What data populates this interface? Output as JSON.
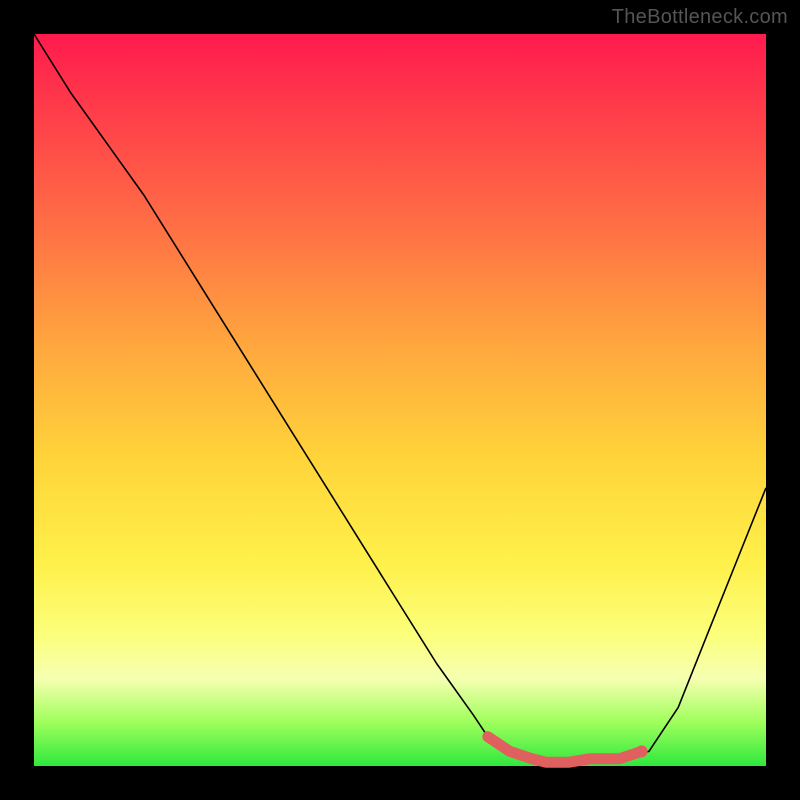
{
  "watermark": "TheBottleneck.com",
  "chart_data": {
    "type": "line",
    "title": "",
    "xlabel": "",
    "ylabel": "",
    "xlim": [
      0,
      100
    ],
    "ylim": [
      0,
      100
    ],
    "series": [
      {
        "name": "bottleneck-curve",
        "x": [
          0,
          5,
          10,
          15,
          20,
          25,
          30,
          35,
          40,
          45,
          50,
          55,
          60,
          62,
          65,
          68,
          70,
          73,
          76,
          80,
          84,
          88,
          92,
          96,
          100
        ],
        "y": [
          100,
          92,
          85,
          78,
          70,
          62,
          54,
          46,
          38,
          30,
          22,
          14,
          7,
          4,
          2,
          1,
          0.5,
          0.5,
          1,
          1,
          2,
          8,
          18,
          28,
          38
        ]
      }
    ],
    "highlight": {
      "name": "optimal-range",
      "x": [
        62,
        65,
        68,
        70,
        73,
        76,
        80,
        83
      ],
      "y": [
        4,
        2,
        1,
        0.5,
        0.5,
        1,
        1,
        2
      ]
    },
    "highlight_end_dot": {
      "x": 83,
      "y": 2
    },
    "grid": false,
    "legend": false
  }
}
